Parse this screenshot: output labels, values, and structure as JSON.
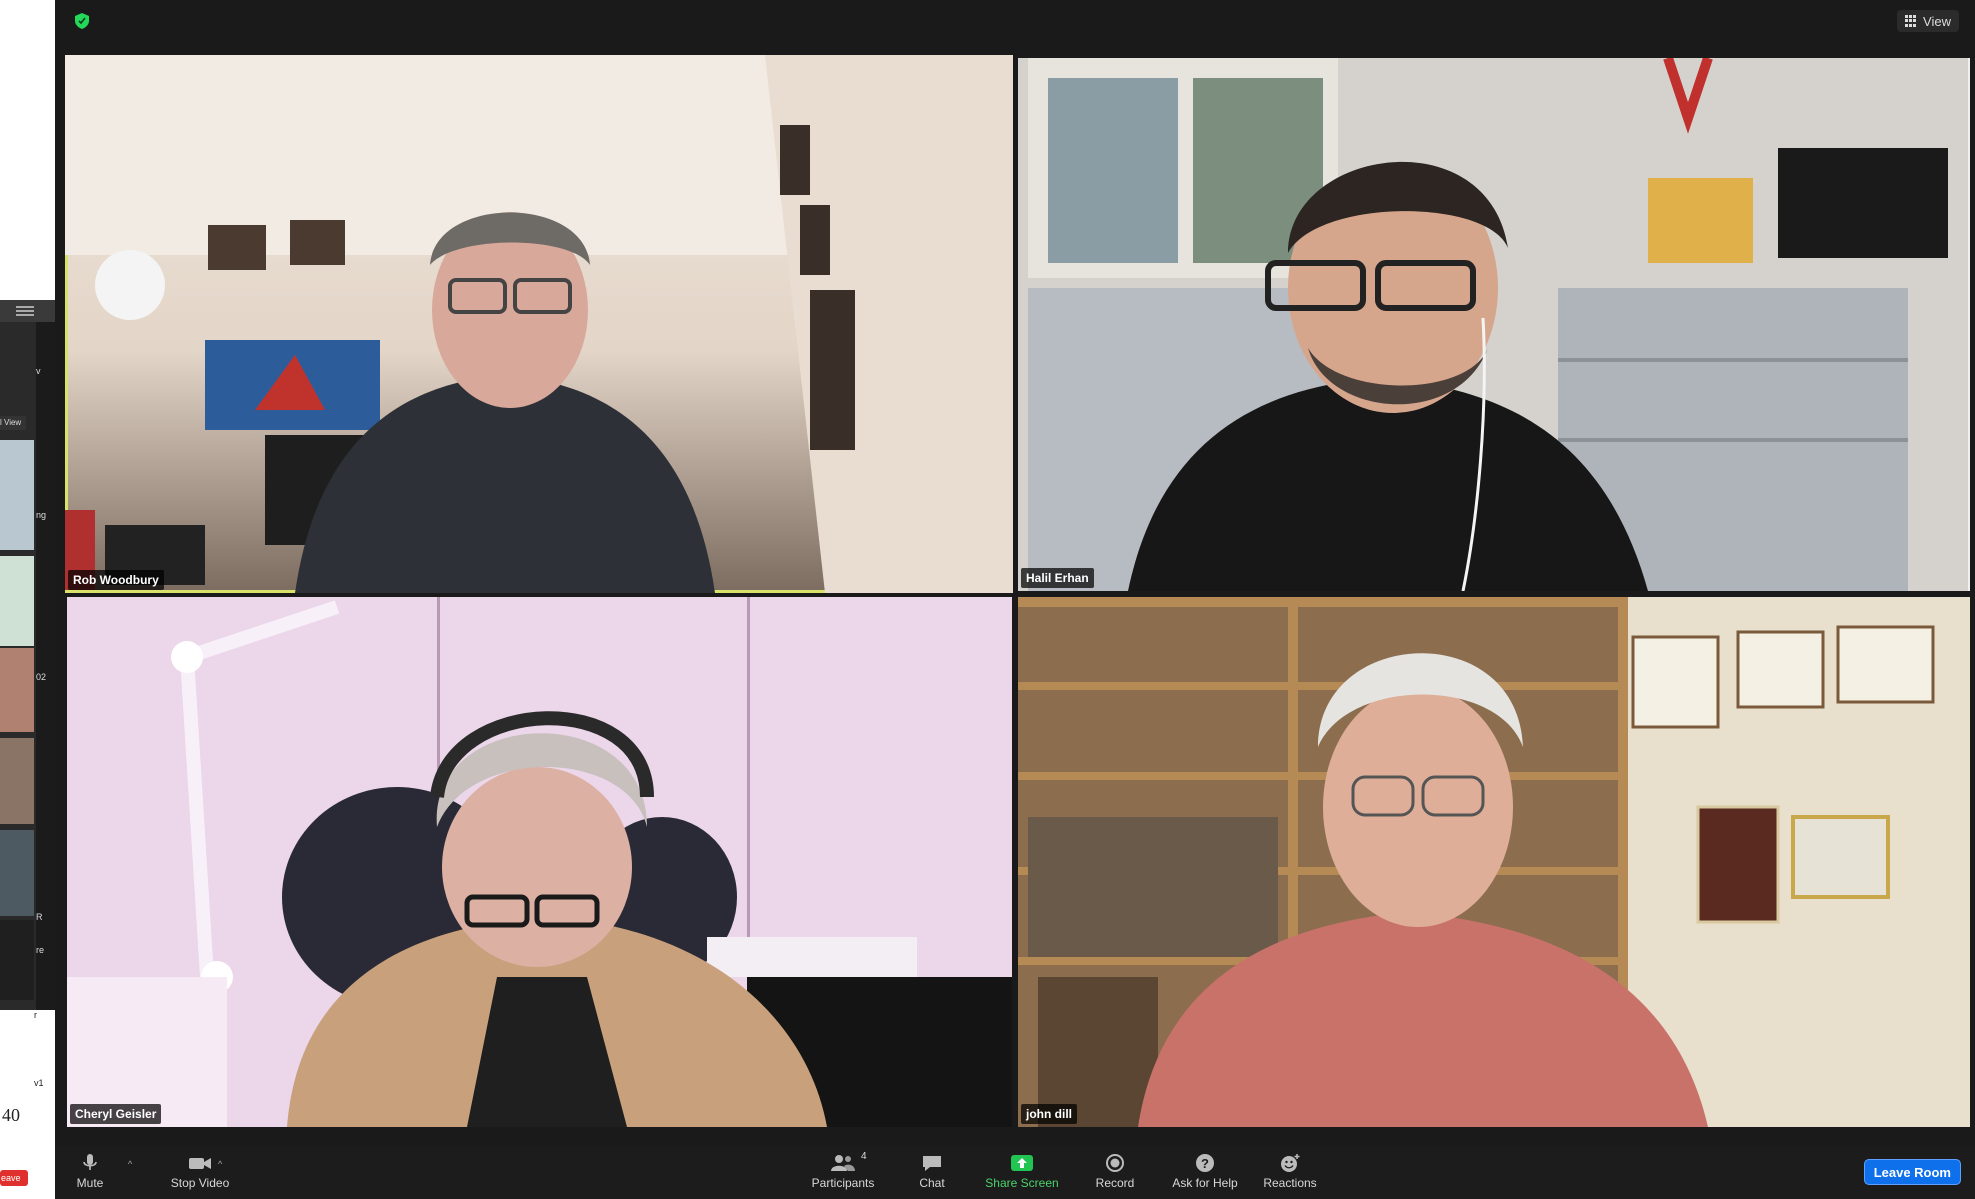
{
  "left_window": {
    "labels": [
      "v",
      "l View",
      "ng",
      "02",
      "R",
      "re",
      "r",
      "v1"
    ],
    "page_number": "40",
    "leave_text": "eave"
  },
  "header": {
    "view_label": "View"
  },
  "participants": [
    {
      "name": "Rob Woodbury",
      "active_speaker": true
    },
    {
      "name": "Halil Erhan",
      "active_speaker": false
    },
    {
      "name": "Cheryl Geisler",
      "active_speaker": false
    },
    {
      "name": "john dill",
      "active_speaker": false
    }
  ],
  "toolbar": {
    "mute_label": "Mute",
    "stop_video_label": "Stop Video",
    "participants_label": "Participants",
    "participants_count": "4",
    "chat_label": "Chat",
    "share_screen_label": "Share Screen",
    "record_label": "Record",
    "ask_for_help_label": "Ask for Help",
    "reactions_label": "Reactions",
    "leave_room_label": "Leave Room"
  },
  "colors": {
    "active_speaker_border": "#d8e26a",
    "share_green": "#4bd36a",
    "leave_blue": "#0e71eb",
    "security_green": "#23d959"
  }
}
